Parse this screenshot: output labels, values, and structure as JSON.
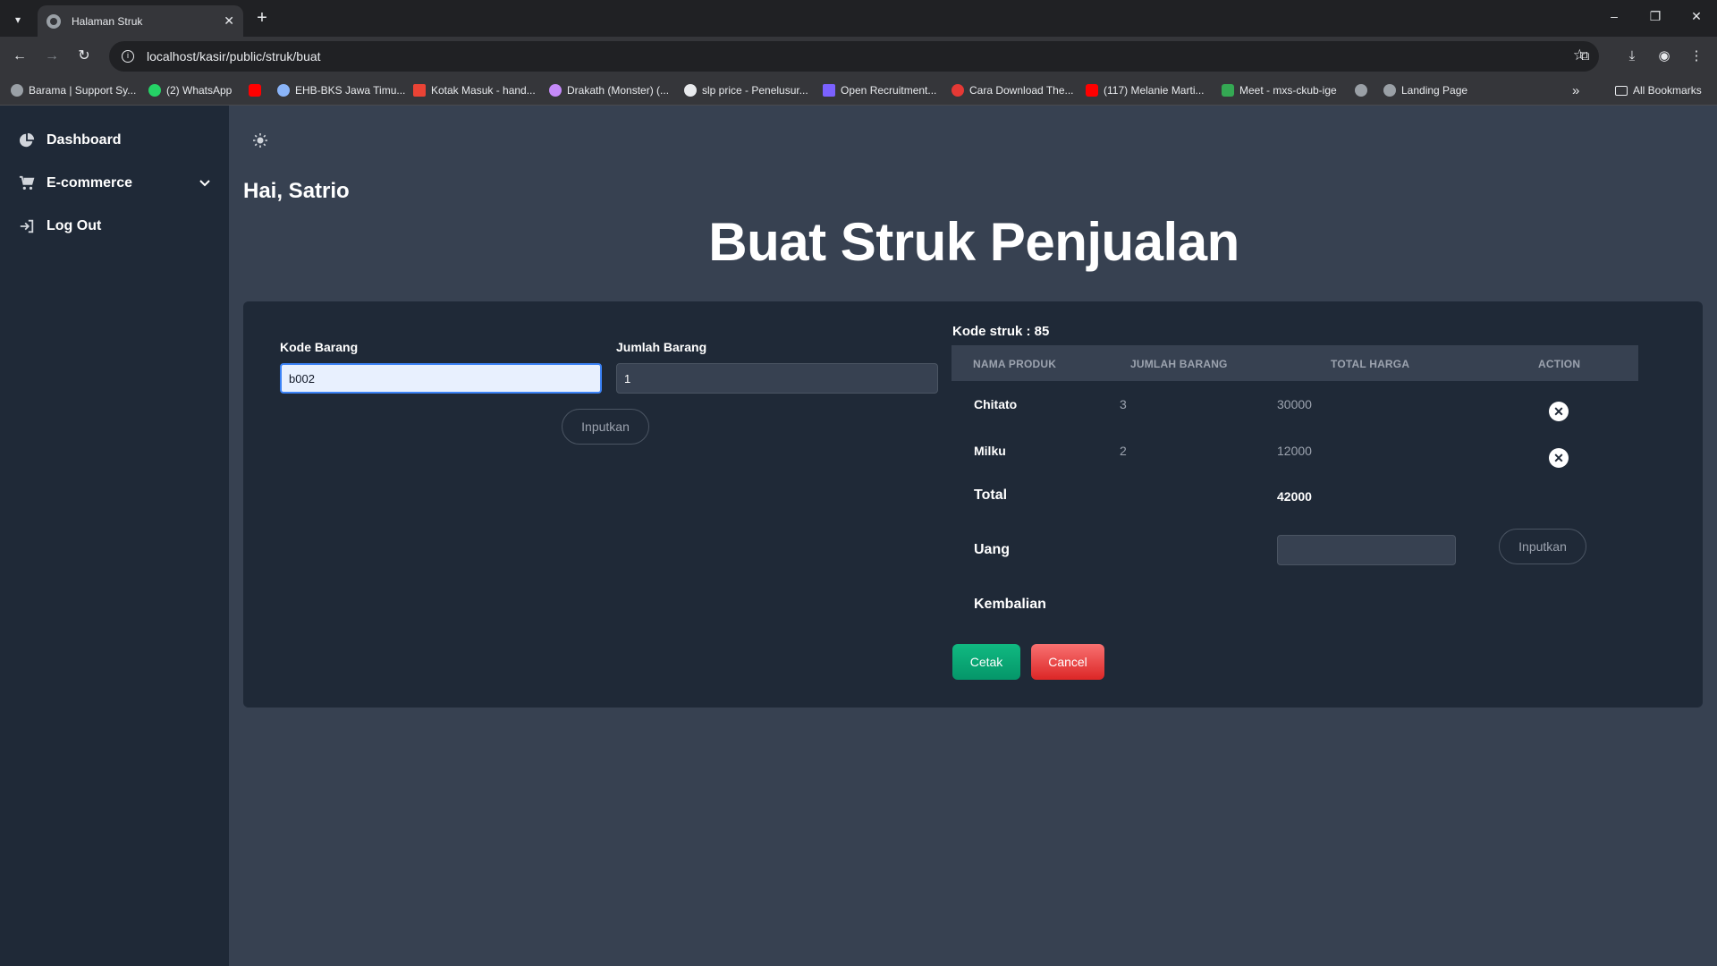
{
  "browser": {
    "tab_title": "Halaman Struk",
    "url": "localhost/kasir/public/struk/buat",
    "bookmarks": [
      {
        "label": "Barama | Support Sy...",
        "color": "#9aa0a6"
      },
      {
        "label": "(2) WhatsApp",
        "color": "#25d366"
      },
      {
        "label": "",
        "color": "#ff0000"
      },
      {
        "label": "EHB-BKS Jawa Timu...",
        "color": "#8ab4f8"
      },
      {
        "label": "Kotak Masuk - hand...",
        "color": "#ea4335"
      },
      {
        "label": "Drakath (Monster) (...",
        "color": "#c58af9"
      },
      {
        "label": "slp price - Penelusur...",
        "color": "#e8eaed"
      },
      {
        "label": "Open Recruitment...",
        "color": "#7b61ff"
      },
      {
        "label": "Cara Download The...",
        "color": "#e53935"
      },
      {
        "label": "(117) Melanie Marti...",
        "color": "#ff0000"
      },
      {
        "label": "Meet - mxs-ckub-ige",
        "color": "#34a853"
      },
      {
        "label": "",
        "color": "#9aa0a6"
      },
      {
        "label": "Landing Page",
        "color": "#9aa0a6"
      }
    ],
    "all_bookmarks": "All Bookmarks"
  },
  "sidebar": {
    "items": [
      {
        "label": "Dashboard",
        "icon": "pie-chart-icon"
      },
      {
        "label": "E-commerce",
        "icon": "cart-icon"
      },
      {
        "label": "Log Out",
        "icon": "logout-icon"
      }
    ]
  },
  "header": {
    "greeting": "Hai, Satrio",
    "title": "Buat Struk Penjualan"
  },
  "form": {
    "kode_label": "Kode Barang",
    "kode_value": "b002",
    "jumlah_label": "Jumlah Barang",
    "jumlah_value": "1",
    "submit_label": "Inputkan"
  },
  "receipt": {
    "kode_struk": "Kode struk : 85",
    "columns": [
      "NAMA PRODUK",
      "JUMLAH BARANG",
      "TOTAL HARGA",
      "ACTION"
    ],
    "rows": [
      {
        "nama": "Chitato",
        "jumlah": "3",
        "total": "30000"
      },
      {
        "nama": "Milku",
        "jumlah": "2",
        "total": "12000"
      }
    ],
    "total_label": "Total",
    "total_value": "42000",
    "uang_label": "Uang",
    "uang_value": "",
    "uang_submit": "Inputkan",
    "kembalian_label": "Kembalian",
    "cetak_label": "Cetak",
    "cancel_label": "Cancel"
  },
  "colors": {
    "cetak": "#10b981",
    "cancel": "#ef4444"
  }
}
